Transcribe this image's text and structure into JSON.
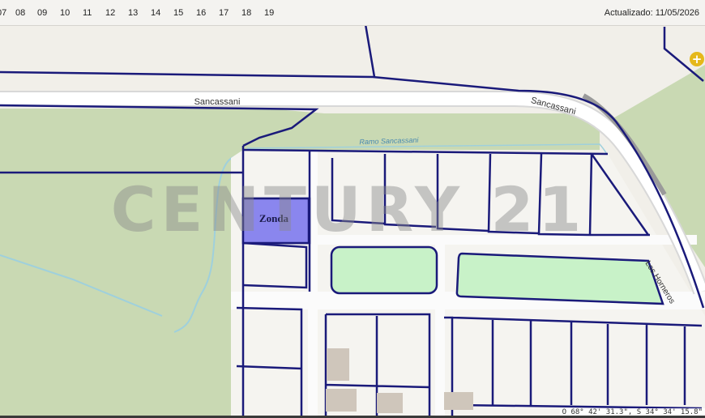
{
  "timeline": {
    "ticks": [
      "07",
      "08",
      "09",
      "10",
      "11",
      "12",
      "13",
      "14",
      "15",
      "16",
      "17",
      "18",
      "19"
    ],
    "updated": "Actualizado: 11/05/2026"
  },
  "map": {
    "streets": {
      "sancassani_left": "Sancassani",
      "sancassani_right": "Sancassani",
      "ramo_sancassani": "Ramo Sancassani",
      "los_horneros": "Los Horneros"
    },
    "selected_parcel": "Zonda",
    "watermark": "CENTURY 21",
    "colors": {
      "parcel_border": "#1a1a7a",
      "selected_fill": "#8a86ee",
      "vegetation": "#c7d8b0",
      "park": "#c6f0c6",
      "street": "#ffffff"
    }
  },
  "controls": {
    "zoom_in": "+"
  },
  "coordinates": "O 68° 42' 31.3\", S 34° 34' 15.8\""
}
